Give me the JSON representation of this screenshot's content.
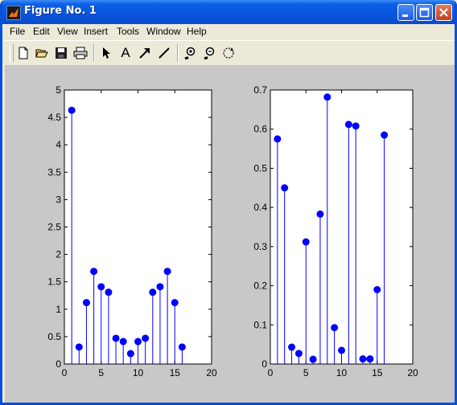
{
  "window": {
    "title": "Figure No. 1",
    "buttons": [
      "minimize",
      "maximize",
      "close"
    ]
  },
  "menu": [
    "File",
    "Edit",
    "View",
    "Insert",
    "Tools",
    "Window",
    "Help"
  ],
  "toolbar": {
    "tools": [
      "new-figure",
      "open-file",
      "save",
      "print",
      "select-arrow",
      "insert-text",
      "insert-arrow",
      "insert-line",
      "zoom-in",
      "zoom-out",
      "rotate-3d"
    ],
    "text_tool_label": "A"
  },
  "colors": {
    "marker": "#0000ff",
    "stem": "#0000ff",
    "figure_bg": "#c8c8c8",
    "axes_bg": "#ffffff",
    "titlebar": "#0855dd"
  },
  "chart_data": [
    {
      "type": "scatter",
      "style": "stem",
      "x": [
        1,
        2,
        3,
        4,
        5,
        6,
        7,
        8,
        9,
        10,
        11,
        12,
        13,
        14,
        15,
        16
      ],
      "y": [
        4.63,
        0.31,
        1.12,
        1.69,
        1.41,
        1.31,
        0.47,
        0.41,
        0.19,
        0.41,
        0.47,
        1.31,
        1.41,
        1.69,
        1.12,
        0.31
      ],
      "xlim": [
        0,
        20
      ],
      "ylim": [
        0,
        5
      ],
      "xticks": [
        "0",
        "5",
        "10",
        "15",
        "20"
      ],
      "yticks": [
        "0",
        "0.5",
        "1",
        "1.5",
        "2",
        "2.5",
        "3",
        "3.5",
        "4",
        "4.5",
        "5"
      ],
      "grid": false
    },
    {
      "type": "scatter",
      "style": "stem",
      "x": [
        1,
        2,
        3,
        4,
        5,
        6,
        7,
        8,
        9,
        10,
        11,
        12,
        13,
        14,
        15,
        16
      ],
      "y": [
        0.575,
        0.45,
        0.043,
        0.027,
        0.312,
        0.012,
        0.383,
        0.682,
        0.093,
        0.035,
        0.612,
        0.608,
        0.013,
        0.013,
        0.19,
        0.585
      ],
      "xlim": [
        0,
        20
      ],
      "ylim": [
        0,
        0.7
      ],
      "xticks": [
        "0",
        "5",
        "10",
        "15",
        "20"
      ],
      "yticks": [
        "0",
        "0.1",
        "0.2",
        "0.3",
        "0.4",
        "0.5",
        "0.6",
        "0.7"
      ],
      "grid": false
    }
  ]
}
